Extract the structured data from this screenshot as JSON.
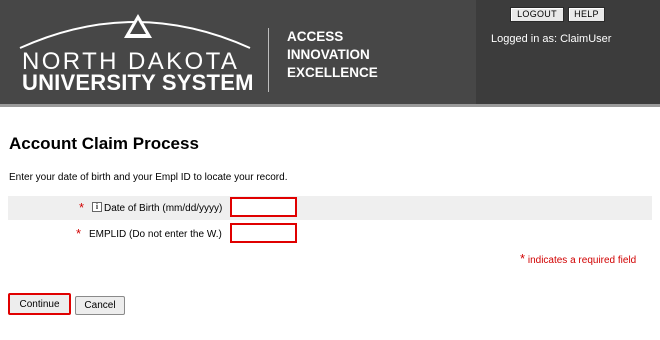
{
  "header": {
    "logo": {
      "line1": "NORTH DAKOTA",
      "line2": "UNIVERSITY SYSTEM"
    },
    "tagline": [
      "ACCESS",
      "INNOVATION",
      "EXCELLENCE"
    ],
    "buttons": {
      "logout": "LOGOUT",
      "help": "HELP"
    },
    "logged_in_text": "Logged in as: ClaimUser"
  },
  "page": {
    "title": "Account Claim Process",
    "instructions": "Enter your date of birth and your Empl ID to locate your record."
  },
  "form": {
    "required_marker": "*",
    "fields": [
      {
        "label": "Date of Birth (mm/dd/yyyy)",
        "value": "",
        "has_info_icon": true,
        "info_icon_glyph": "i"
      },
      {
        "label": "EMPLID (Do not enter the W.)",
        "value": "",
        "has_info_icon": false
      }
    ],
    "required_note": "indicates a required field"
  },
  "actions": {
    "continue": "Continue",
    "cancel": "Cancel"
  },
  "colors": {
    "header_bg": "#474747",
    "required_red": "#d10000",
    "highlight_red": "#e00000"
  }
}
